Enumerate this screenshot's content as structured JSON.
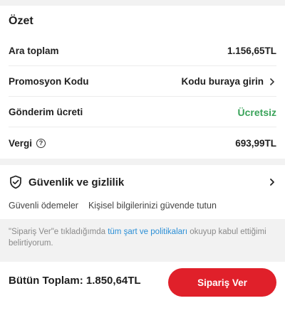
{
  "summary": {
    "title": "Özet",
    "rows": [
      {
        "label": "Ara toplam",
        "value": "1.156,65TL"
      },
      {
        "label": "Promosyon Kodu",
        "value": "Kodu buraya girin"
      },
      {
        "label": "Gönderim ücreti",
        "value": "Ücretsiz"
      },
      {
        "label": "Vergi",
        "value": "693,99TL"
      }
    ],
    "free_color": "#3aa35a"
  },
  "security": {
    "title": "Güvenlik ve gizlilik",
    "items": [
      "Güvenli ödemeler",
      "Kişisel bilgilerinizi güvende tutun"
    ]
  },
  "consent": {
    "prefix": "\"Sipariş Ver\"e tıkladığımda ",
    "link": "tüm şart ve politikaları",
    "suffix": " okuyup kabul ettiğimi belirtiyorum."
  },
  "footer": {
    "total_text": "Bütün Toplam: 1.850,64TL",
    "order_label": "Sipariş Ver",
    "accent": "#e0202a"
  },
  "icons": {
    "shield": "shield-check-icon",
    "chevron": "chevron-right-icon",
    "info": "info-icon"
  }
}
